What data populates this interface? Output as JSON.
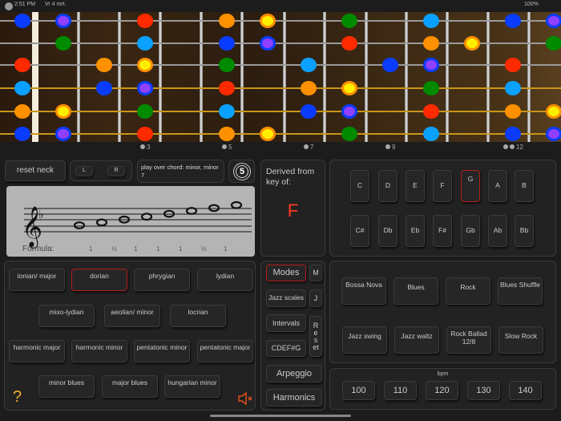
{
  "status": {
    "time": "2:51 PM",
    "date": "Vr 4 mrt.",
    "battery": "100%"
  },
  "colors": {
    "blue": "#0a3cff",
    "lightblue": "#0aa0ff",
    "red": "#ff2a00",
    "orange": "#ff9000",
    "green": "#008a00",
    "yellow": "#ffee00",
    "purple": "#9040ff",
    "accent": "#b0201a",
    "key": "#ff3b1f"
  },
  "fretboard": {
    "strings": [
      [
        [
          0,
          "blue"
        ],
        [
          1,
          "purple"
        ],
        [
          3,
          "red"
        ],
        [
          5,
          "orange"
        ],
        [
          6,
          "yellow"
        ],
        [
          8,
          "green"
        ],
        [
          10,
          "lightblue"
        ],
        [
          12,
          "blue"
        ],
        [
          13,
          "purple"
        ]
      ],
      [
        [
          1,
          "green"
        ],
        [
          3,
          "lightblue"
        ],
        [
          5,
          "blue"
        ],
        [
          6,
          "purple"
        ],
        [
          8,
          "red"
        ],
        [
          10,
          "orange"
        ],
        [
          11,
          "yellow"
        ],
        [
          13,
          "green"
        ]
      ],
      [
        [
          0,
          "red"
        ],
        [
          2,
          "orange"
        ],
        [
          3,
          "yellow"
        ],
        [
          5,
          "green"
        ],
        [
          7,
          "lightblue"
        ],
        [
          9,
          "blue"
        ],
        [
          10,
          "purple"
        ],
        [
          12,
          "red"
        ]
      ],
      [
        [
          0,
          "lightblue"
        ],
        [
          2,
          "blue"
        ],
        [
          3,
          "purple"
        ],
        [
          5,
          "red"
        ],
        [
          7,
          "orange"
        ],
        [
          8,
          "yellow"
        ],
        [
          10,
          "green"
        ],
        [
          12,
          "lightblue"
        ]
      ],
      [
        [
          0,
          "orange"
        ],
        [
          1,
          "yellow"
        ],
        [
          3,
          "green"
        ],
        [
          5,
          "lightblue"
        ],
        [
          7,
          "blue"
        ],
        [
          8,
          "purple"
        ],
        [
          10,
          "red"
        ],
        [
          12,
          "orange"
        ],
        [
          13,
          "yellow"
        ]
      ],
      [
        [
          0,
          "blue"
        ],
        [
          1,
          "purple"
        ],
        [
          3,
          "red"
        ],
        [
          5,
          "orange"
        ],
        [
          6,
          "yellow"
        ],
        [
          8,
          "green"
        ],
        [
          10,
          "lightblue"
        ],
        [
          12,
          "blue"
        ],
        [
          13,
          "purple"
        ]
      ]
    ],
    "markers": [
      "3",
      "5",
      "7",
      "9",
      "12"
    ]
  },
  "controls": {
    "reset_neck": "reset neck",
    "left": "L",
    "right": "R",
    "chord_hint": "play over chord: minor, minor 7",
    "circle_of_fifths": "5"
  },
  "derived": {
    "label": "Derived from key of:",
    "key": "F"
  },
  "score": {
    "formula_label": "Formula:",
    "formula": [
      "1",
      "½",
      "1",
      "1",
      "1",
      "½",
      "1"
    ],
    "note_steps": [
      0,
      1,
      2,
      3,
      4,
      5,
      6,
      7
    ]
  },
  "keys": {
    "row1": [
      "C",
      "D",
      "E",
      "F",
      "G",
      "A",
      "B"
    ],
    "row2": [
      "C#",
      "Db",
      "Eb",
      "F#",
      "Gb",
      "Ab",
      "Bb"
    ],
    "selected": "G"
  },
  "modes": {
    "items": [
      "ionian/ major",
      "dorian",
      "phrygian",
      "lydian",
      "mixo-lydian",
      "aeolian/ minor",
      "locrian",
      "harmonic major",
      "harmonic minor",
      "pentatonic minor",
      "pentatonic major",
      "minor blues",
      "major blues",
      "hungarian minor"
    ],
    "selected": "dorian",
    "help": "?"
  },
  "categories": {
    "modes": "Modes",
    "m": "M",
    "jazz": "Jazz scales",
    "j": "J",
    "intervals": "Intervals",
    "reset": "Reset",
    "cdefg": "CDEF#G",
    "arpeggio": "Arpeggio",
    "harmonics": "Harmonics"
  },
  "rhythms": [
    "Bossa Nova",
    "Blues",
    "Rock",
    "Blues Shuffle",
    "Jazz swing",
    "Jazz waltz",
    "Rock Ballad 12/8",
    "Slow Rock"
  ],
  "bpm": {
    "label": "bpm",
    "values": [
      "100",
      "110",
      "120",
      "130",
      "140"
    ]
  }
}
